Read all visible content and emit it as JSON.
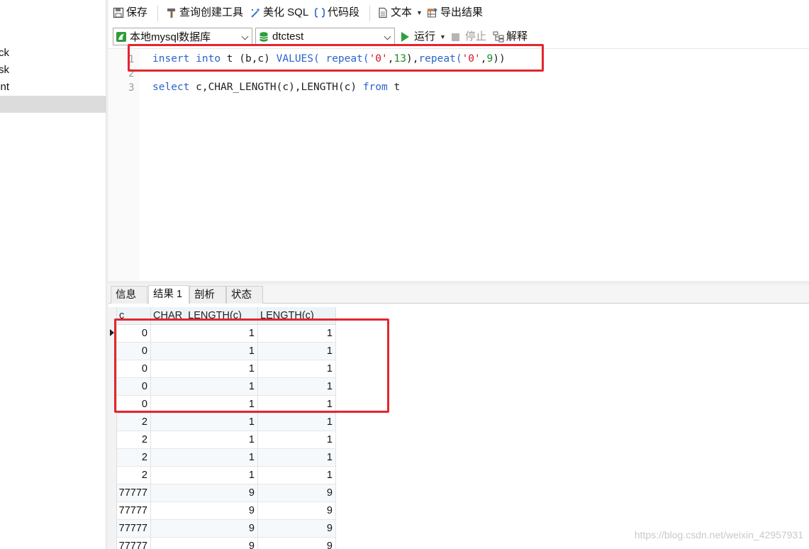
{
  "sidebar": {
    "items": [
      {
        "label": "ck"
      },
      {
        "label": "ask"
      },
      {
        "label": "nt"
      },
      {
        "label": ""
      }
    ]
  },
  "toolbar": {
    "save": "保存",
    "query_builder": "查询创建工具",
    "beautify": "美化 SQL",
    "snippet": "代码段",
    "text": "文本",
    "export": "导出结果"
  },
  "connection_bar": {
    "connection": "本地mysql数据库",
    "database": "dtctest",
    "run": "运行",
    "stop": "停止",
    "explain": "解释"
  },
  "editor": {
    "line_numbers": [
      "1",
      "2",
      "3"
    ],
    "line1": {
      "insert": "insert",
      "into": "into",
      "table": " t (b,c) ",
      "values": "VALUES(",
      "sp": " ",
      "repeat1": "repeat(",
      "str1": "'0'",
      "comma1": ",",
      "num1": "13",
      "close1": "),",
      "repeat2": "repeat(",
      "str2": "'0'",
      "comma2": ",",
      "num2": "9",
      "close2": "))"
    },
    "line3": {
      "select": "select",
      "cols": " c,CHAR_LENGTH(c),LENGTH(c) ",
      "from": "from",
      "table": " t"
    }
  },
  "result_tabs": [
    "信息",
    "结果 1",
    "剖析",
    "状态"
  ],
  "active_tab": 1,
  "grid": {
    "columns": [
      "c",
      "CHAR_LENGTH(c)",
      "LENGTH(c)"
    ],
    "rows": [
      [
        "0",
        "1",
        "1"
      ],
      [
        "0",
        "1",
        "1"
      ],
      [
        "0",
        "1",
        "1"
      ],
      [
        "0",
        "1",
        "1"
      ],
      [
        "0",
        "1",
        "1"
      ],
      [
        "2",
        "1",
        "1"
      ],
      [
        "2",
        "1",
        "1"
      ],
      [
        "2",
        "1",
        "1"
      ],
      [
        "2",
        "1",
        "1"
      ],
      [
        "77777",
        "9",
        "9"
      ],
      [
        "77777",
        "9",
        "9"
      ],
      [
        "77777",
        "9",
        "9"
      ],
      [
        "77777",
        "9",
        "9"
      ]
    ]
  },
  "watermark": "https://blog.csdn.net/weixin_42957931",
  "colors": {
    "highlight": "#e3262f",
    "keyword": "#2a64c9",
    "string": "#d6122c",
    "number": "#1c8c28",
    "run_icon": "#2ea043",
    "db_icon": "#2e9d3a"
  }
}
